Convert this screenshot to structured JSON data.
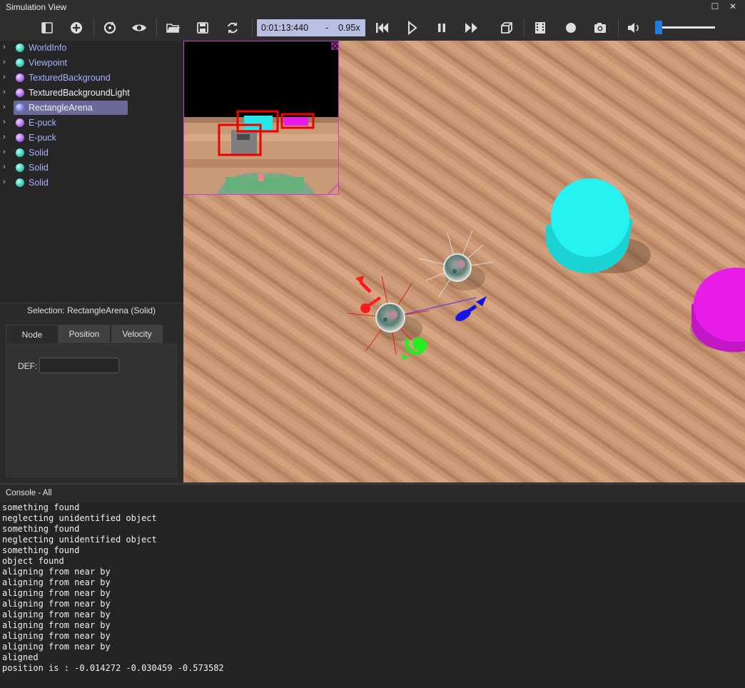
{
  "window": {
    "title": "Simulation View",
    "maximize_icon": "maximize-icon",
    "close_icon": "close-icon"
  },
  "toolbar": {
    "icons": [
      "toggle-scene-tree-icon",
      "add-node-icon",
      "reset-simulation-icon",
      "show-icon",
      "open-world-icon",
      "save-world-icon",
      "reload-world-icon",
      "step-back-icon",
      "play-icon",
      "pause-icon",
      "fast-forward-icon",
      "3d-view-icon",
      "film-icon",
      "record-icon",
      "camera-icon",
      "volume-icon"
    ],
    "time": "0:01:13:440",
    "time_dash": "-",
    "speed": "0.95x",
    "volume_level": 0.05,
    "accent_color": "#1e7fe0"
  },
  "scene_tree": {
    "items": [
      {
        "label": "WorldInfo",
        "ball": "teal"
      },
      {
        "label": "Viewpoint",
        "ball": "teal"
      },
      {
        "label": "TexturedBackground",
        "ball": "purple"
      },
      {
        "label": "TexturedBackgroundLight",
        "ball": "purple"
      },
      {
        "label": "RectangleArena",
        "ball": "blue",
        "selected": true
      },
      {
        "label": "E-puck",
        "ball": "purple"
      },
      {
        "label": "E-puck",
        "ball": "purple"
      },
      {
        "label": "Solid",
        "ball": "teal"
      },
      {
        "label": "Solid",
        "ball": "teal"
      },
      {
        "label": "Solid",
        "ball": "teal"
      }
    ],
    "selected_color": "#6a6a9a"
  },
  "selection": {
    "title": "Selection: RectangleArena (Solid)",
    "tabs": [
      "Node",
      "Position",
      "Velocity"
    ],
    "active_tab": "Node",
    "def_label": "DEF:",
    "def_value": ""
  },
  "console": {
    "title": "Console - All",
    "lines": [
      "something found",
      "neglecting unidentified object",
      "something found",
      "neglecting unidentified object",
      "something found",
      "object found",
      "aligning from near by",
      "aligning from near by",
      "aligning from near by",
      "aligning from near by",
      "aligning from near by",
      "aligning from near by",
      "aligning from near by",
      "aligning from near by",
      "aligned",
      "position is : -0.014272 -0.030459 -0.573582"
    ]
  },
  "scene_colors": {
    "floor": "#c28f68",
    "cyan_object": "#27f2f2",
    "magenta_object": "#e81ee8",
    "camera_frame": "#d23ad2"
  }
}
